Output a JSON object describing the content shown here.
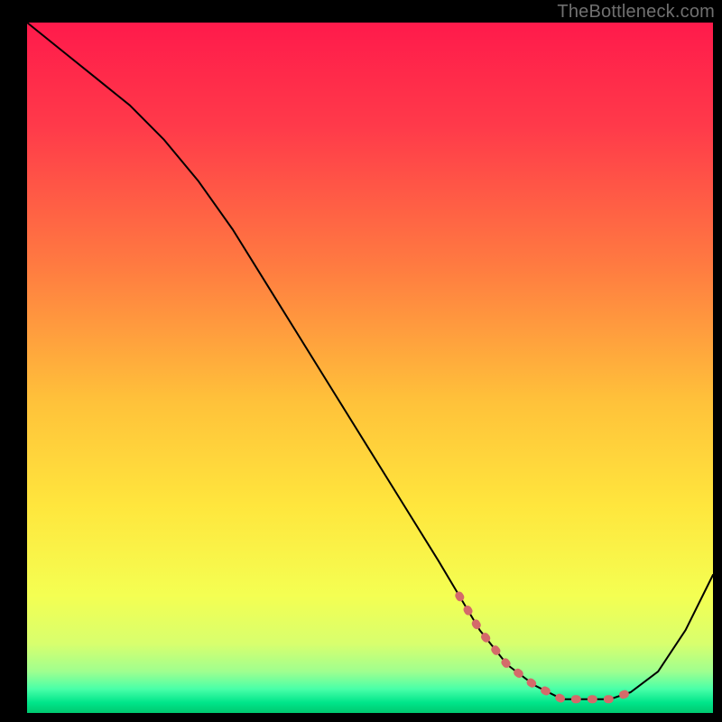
{
  "watermark": "TheBottleneck.com",
  "chart_data": {
    "type": "line",
    "title": "",
    "xlabel": "",
    "ylabel": "",
    "xlim": [
      0,
      100
    ],
    "ylim": [
      0,
      100
    ],
    "gradient_stops": [
      {
        "offset": 0.0,
        "color": "#ff1a4b"
      },
      {
        "offset": 0.15,
        "color": "#ff3a4a"
      },
      {
        "offset": 0.35,
        "color": "#ff7a41"
      },
      {
        "offset": 0.55,
        "color": "#ffc23a"
      },
      {
        "offset": 0.7,
        "color": "#ffe63d"
      },
      {
        "offset": 0.83,
        "color": "#f4ff52"
      },
      {
        "offset": 0.9,
        "color": "#d8ff6e"
      },
      {
        "offset": 0.94,
        "color": "#9fff8f"
      },
      {
        "offset": 0.965,
        "color": "#4affa8"
      },
      {
        "offset": 0.985,
        "color": "#00e58a"
      },
      {
        "offset": 1.0,
        "color": "#00c86f"
      }
    ],
    "series": [
      {
        "name": "curve",
        "x": [
          0,
          5,
          10,
          15,
          20,
          25,
          30,
          35,
          40,
          45,
          50,
          55,
          60,
          63,
          66,
          70,
          74,
          78,
          82,
          85,
          88,
          92,
          96,
          100
        ],
        "y": [
          100,
          96,
          92,
          88,
          83,
          77,
          70,
          62,
          54,
          46,
          38,
          30,
          22,
          17,
          12,
          7,
          4,
          2,
          2,
          2,
          3,
          6,
          12,
          20
        ]
      }
    ],
    "highlight_segment": {
      "color": "#d46a6a",
      "x": [
        63,
        66,
        70,
        74,
        78,
        82,
        85,
        88
      ],
      "y": [
        17,
        12,
        7,
        4,
        2,
        2,
        2,
        3
      ]
    }
  }
}
